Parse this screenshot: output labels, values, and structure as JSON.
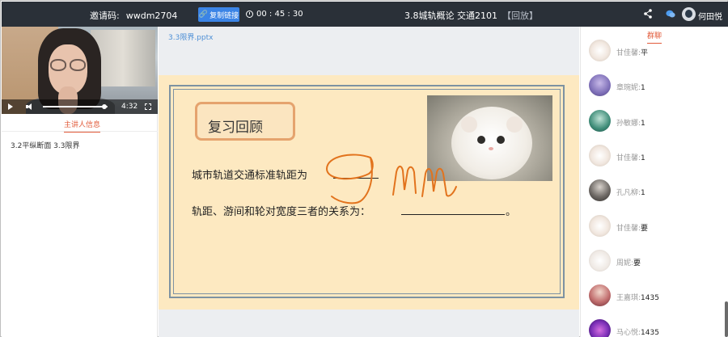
{
  "topbar": {
    "invite_label": "邀请码:",
    "invite_code": "wwdm2704",
    "copy_button": "复制链接",
    "timer": "00 : 45 : 30",
    "course_title": "3.8城轨概论 交通2101",
    "replay_tag": "【回放】",
    "user_name": "何田悦"
  },
  "video": {
    "duration": "4:32",
    "progress": 0.95
  },
  "left_panel": {
    "tab_label": "主讲人信息",
    "chapter": "3.2平纵断面 3.3限界"
  },
  "slide": {
    "filename": "3.3限界.pptx",
    "title": "复习回顾",
    "q1": "城市轨道交通标准轨距为",
    "q2": "轨距、游间和轮对宽度三者的关系为：",
    "q2_end": "。",
    "handwriting": "9mm"
  },
  "chat": {
    "tab_label": "群聊",
    "messages": [
      {
        "name": "甘佳馨:",
        "content": "平",
        "avatar": "cat-avatar"
      },
      {
        "name": "章琬妮:",
        "content": "1",
        "avatar": "anime-avatar"
      },
      {
        "name": "孙敏娜:",
        "content": "1",
        "avatar": "cartoon-avatar"
      },
      {
        "name": "甘佳馨:",
        "content": "1",
        "avatar": "cat-avatar"
      },
      {
        "name": "孔凡柳:",
        "content": "1",
        "avatar": "person-avatar"
      },
      {
        "name": "甘佳馨:",
        "content": "要",
        "avatar": "cat-avatar"
      },
      {
        "name": "周妮:",
        "content": "要",
        "avatar": "flower-avatar"
      },
      {
        "name": "王嘉琪:",
        "content": "1435",
        "avatar": "girl-avatar"
      },
      {
        "name": "马心悦:",
        "content": "1435",
        "avatar": "purple-avatar"
      }
    ]
  }
}
